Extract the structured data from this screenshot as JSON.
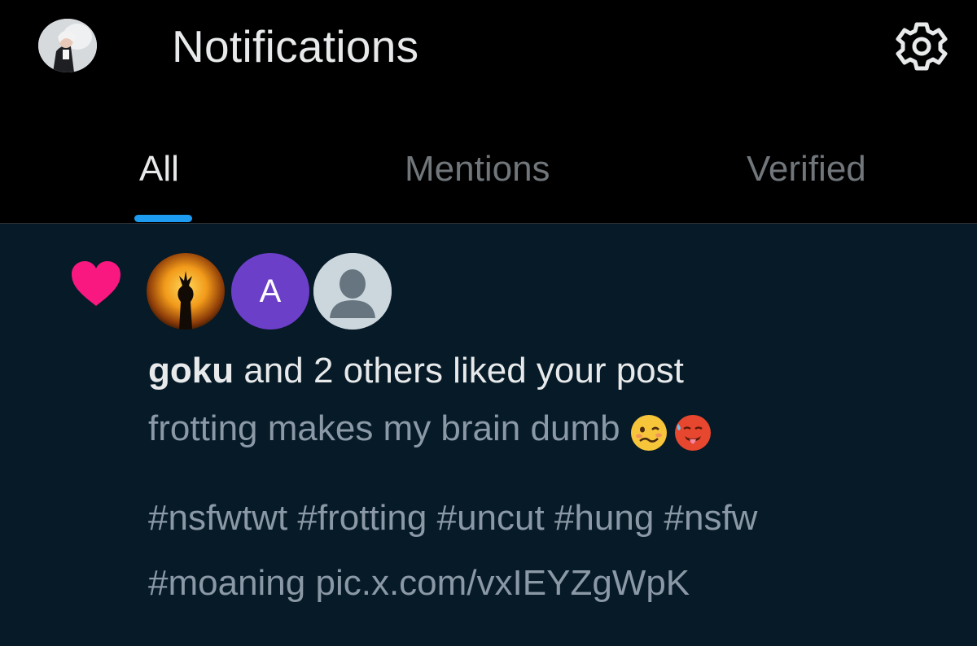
{
  "header": {
    "title": "Notifications",
    "avatar": "profile-avatar",
    "settings_icon": "gear-icon"
  },
  "tabs": [
    {
      "label": "All",
      "active": true
    },
    {
      "label": "Mentions",
      "active": false
    },
    {
      "label": "Verified",
      "active": false
    }
  ],
  "notification": {
    "type_icon": "heart-icon",
    "liker_avatars": [
      "goku-avatar",
      "letter-avatar",
      "default-avatar"
    ],
    "liker_initial": "A",
    "actor": "goku",
    "action": " and 2 others liked your post",
    "post_line1": "frotting makes my brain dumb",
    "post_emojis": [
      "woozy-face-emoji",
      "hot-face-emoji"
    ],
    "post_line2": "#nsfwtwt #frotting #uncut #hung #nsfw",
    "post_line3": "#moaning pic.x.com/vxIEYZgWpK"
  },
  "colors": {
    "background_header": "#000000",
    "background_item": "#061a28",
    "accent": "#1d9bf0",
    "like": "#f91880",
    "text_primary": "#e7e9ea",
    "text_secondary": "#8b98a5",
    "avatar_purple": "#6c3fc9"
  }
}
